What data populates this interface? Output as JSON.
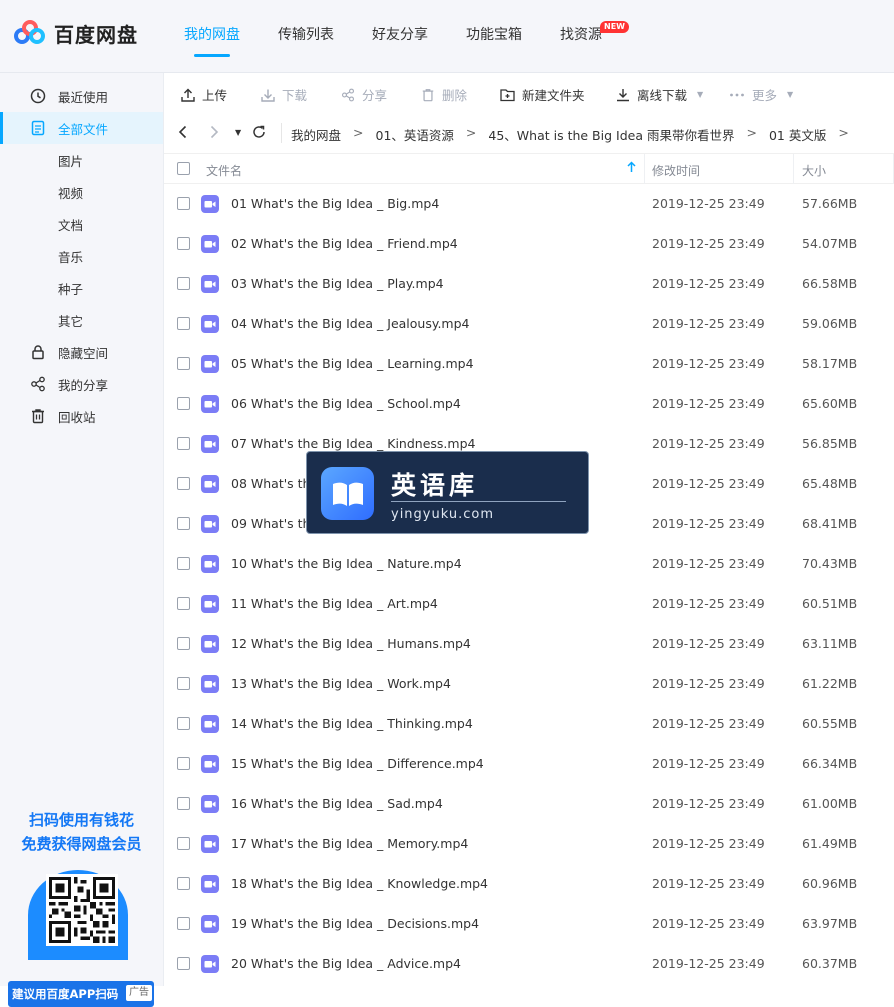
{
  "logo": {
    "text": "百度网盘"
  },
  "nav": [
    {
      "label": "我的网盘",
      "active": true
    },
    {
      "label": "传输列表"
    },
    {
      "label": "好友分享"
    },
    {
      "label": "功能宝箱"
    },
    {
      "label": "找资源",
      "badge": "NEW"
    }
  ],
  "sidebar": {
    "items": [
      {
        "label": "最近使用",
        "icon": "clock-icon"
      },
      {
        "label": "全部文件",
        "icon": "file-icon",
        "active": true
      },
      {
        "label": "图片"
      },
      {
        "label": "视频"
      },
      {
        "label": "文档"
      },
      {
        "label": "音乐"
      },
      {
        "label": "种子"
      },
      {
        "label": "其它"
      },
      {
        "label": "隐藏空间",
        "icon": "lock-icon"
      },
      {
        "label": "我的分享",
        "icon": "share-icon"
      },
      {
        "label": "回收站",
        "icon": "trash-icon"
      }
    ],
    "ad": {
      "line1": "扫码使用有钱花",
      "line2": "免费获得网盘会员",
      "bottom": "建议用百度APP扫码",
      "tag": "广告"
    }
  },
  "toolbar": {
    "upload": "上传",
    "download": "下载",
    "share": "分享",
    "delete": "删除",
    "new_folder": "新建文件夹",
    "offline_download": "离线下载",
    "more": "更多"
  },
  "breadcrumb": [
    "我的网盘",
    "01、英语资源",
    "45、What is the Big Idea 雨果带你看世界",
    "01 英文版"
  ],
  "table": {
    "headers": {
      "name": "文件名",
      "modified": "修改时间",
      "size": "大小"
    },
    "rows": [
      {
        "name": "01 What's the Big Idea _ Big.mp4",
        "date": "2019-12-25 23:49",
        "size": "57.66MB"
      },
      {
        "name": "02 What's the Big Idea _ Friend.mp4",
        "date": "2019-12-25 23:49",
        "size": "54.07MB"
      },
      {
        "name": "03 What's the Big Idea _ Play.mp4",
        "date": "2019-12-25 23:49",
        "size": "66.58MB"
      },
      {
        "name": "04 What's the Big Idea _ Jealousy.mp4",
        "date": "2019-12-25 23:49",
        "size": "59.06MB"
      },
      {
        "name": "05 What's the Big Idea _ Learning.mp4",
        "date": "2019-12-25 23:49",
        "size": "58.17MB"
      },
      {
        "name": "06 What's the Big Idea _ School.mp4",
        "date": "2019-12-25 23:49",
        "size": "65.60MB"
      },
      {
        "name": "07 What's the Big Idea _ Kindness.mp4",
        "date": "2019-12-25 23:49",
        "size": "56.85MB"
      },
      {
        "name": "08 What's th",
        "date": "2019-12-25 23:49",
        "size": "65.48MB"
      },
      {
        "name": "09 What's th",
        "date": "2019-12-25 23:49",
        "size": "68.41MB"
      },
      {
        "name": "10 What's the Big Idea _ Nature.mp4",
        "date": "2019-12-25 23:49",
        "size": "70.43MB"
      },
      {
        "name": "11 What's the Big Idea _ Art.mp4",
        "date": "2019-12-25 23:49",
        "size": "60.51MB"
      },
      {
        "name": "12 What's the Big Idea _ Humans.mp4",
        "date": "2019-12-25 23:49",
        "size": "63.11MB"
      },
      {
        "name": "13 What's the Big Idea _ Work.mp4",
        "date": "2019-12-25 23:49",
        "size": "61.22MB"
      },
      {
        "name": "14 What's the Big Idea _ Thinking.mp4",
        "date": "2019-12-25 23:49",
        "size": "60.55MB"
      },
      {
        "name": "15 What's the Big Idea _ Difference.mp4",
        "date": "2019-12-25 23:49",
        "size": "66.34MB"
      },
      {
        "name": "16 What's the Big Idea _ Sad.mp4",
        "date": "2019-12-25 23:49",
        "size": "61.00MB"
      },
      {
        "name": "17 What's the Big Idea _ Memory.mp4",
        "date": "2019-12-25 23:49",
        "size": "61.49MB"
      },
      {
        "name": "18 What's the Big Idea _ Knowledge.mp4",
        "date": "2019-12-25 23:49",
        "size": "60.96MB"
      },
      {
        "name": "19 What's the Big Idea _ Decisions.mp4",
        "date": "2019-12-25 23:49",
        "size": "63.97MB"
      },
      {
        "name": "20 What's the Big Idea _ Advice.mp4",
        "date": "2019-12-25 23:49",
        "size": "60.37MB"
      }
    ]
  },
  "watermark": {
    "title": "英语库",
    "subtitle": "yingyuku.com"
  },
  "colors": {
    "accent": "#06a7ff",
    "video_icon": "#7b7cf6"
  }
}
